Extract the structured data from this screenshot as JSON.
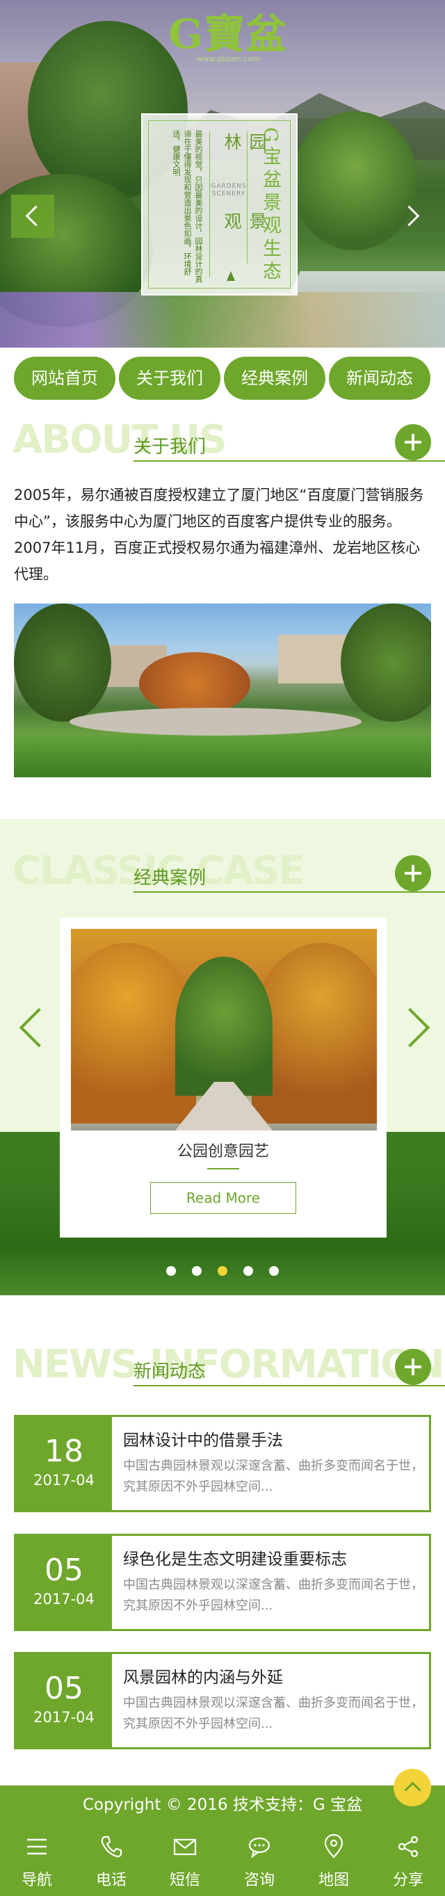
{
  "hero": {
    "logo_text": "G寶盆",
    "logo_url": "www.gbpen.com",
    "panel": {
      "tagline": "最美的视觉，只因最美的设计，园林设计的真谛在于懂得发现和营造出景色如画，环境舒适，健康文明",
      "title_left": "园林",
      "title_left_2": "景观",
      "english": "GARDENS SCENERY",
      "title_right": "G宝盆景观生态"
    }
  },
  "nav": [
    "网站首页",
    "关于我们",
    "经典案例",
    "新闻动态"
  ],
  "about": {
    "en": "ABOUT US",
    "cn": "关于我们",
    "text": "2005年，易尔通被百度授权建立了厦门地区“百度厦门营销服务中心”，该服务中心为厦门地区的百度客户提供专业的服务。2007年11月，百度正式授权易尔通为福建漳州、龙岩地区核心代理。"
  },
  "cases": {
    "en": "CLASSIC CASE",
    "cn": "经典案例",
    "item_title": "公园创意园艺",
    "more": "Read More",
    "dots": 5,
    "active_dot": 2
  },
  "news": {
    "en": "NEWS INFORMATION",
    "cn": "新闻动态",
    "items": [
      {
        "day": "18",
        "ym": "2017-04",
        "title": "园林设计中的借景手法",
        "excerpt": "中国古典园林景观以深邃含蓄、曲折多变而闻名于世，究其原因不外乎园林空间..."
      },
      {
        "day": "05",
        "ym": "2017-04",
        "title": "绿色化是生态文明建设重要标志",
        "excerpt": "中国古典园林景观以深邃含蓄、曲折多变而闻名于世，究其原因不外乎园林空间..."
      },
      {
        "day": "05",
        "ym": "2017-04",
        "title": "风景园林的内涵与外延",
        "excerpt": "中国古典园林景观以深邃含蓄、曲折多变而闻名于世，究其原因不外乎园林空间..."
      }
    ]
  },
  "footer": {
    "copyright": "Copyright © 2016  技术支持：G 宝盆"
  },
  "tabbar": [
    {
      "label": "导航",
      "icon": "menu-icon"
    },
    {
      "label": "电话",
      "icon": "phone-icon"
    },
    {
      "label": "短信",
      "icon": "mail-icon"
    },
    {
      "label": "咨询",
      "icon": "chat-icon"
    },
    {
      "label": "地图",
      "icon": "map-pin-icon"
    },
    {
      "label": "分享",
      "icon": "share-icon"
    }
  ],
  "colors": {
    "brand_green": "#6ea72b",
    "light_green": "#eef8e0",
    "accent_yellow": "#f2d33a"
  }
}
